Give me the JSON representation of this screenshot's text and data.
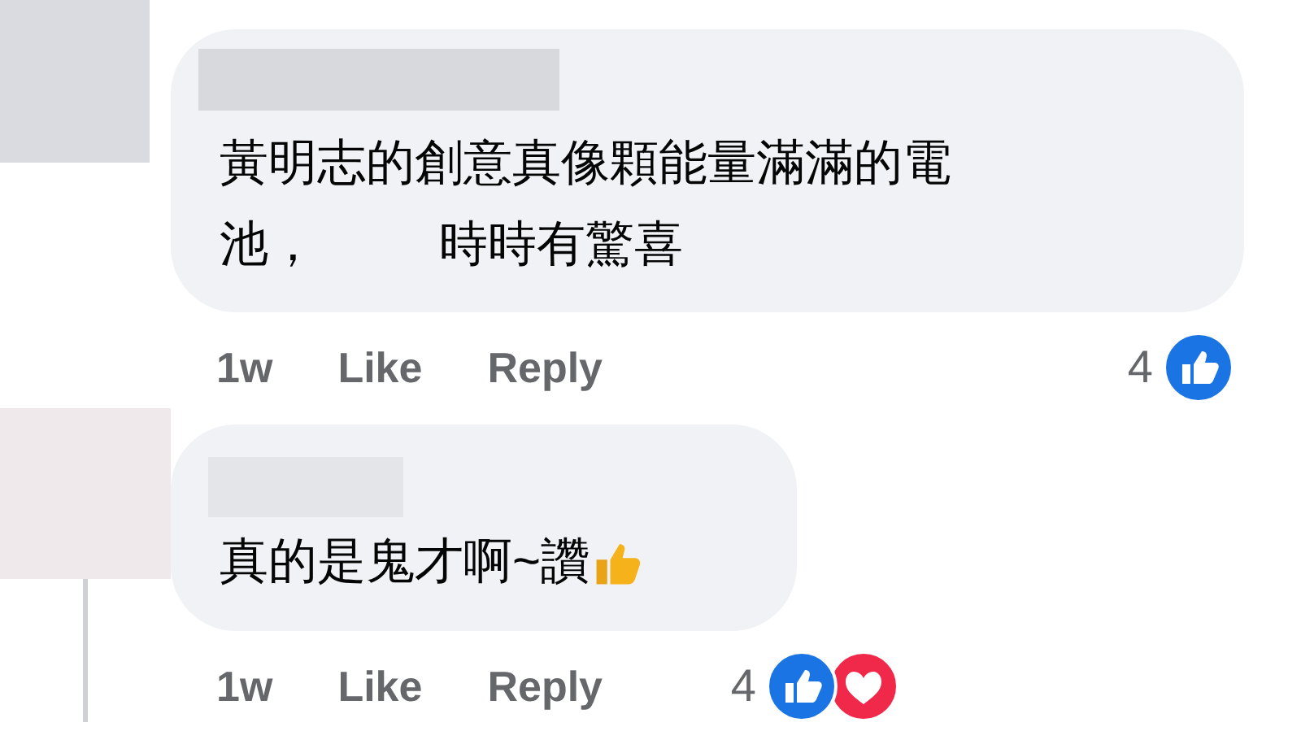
{
  "comments": [
    {
      "lines": [
        [
          "黃明志的創意真像顆能量滿滿的電"
        ],
        [
          "池，",
          "時時有驚喜"
        ]
      ],
      "emoji": false,
      "thread_line": false,
      "time": "1w",
      "like": "Like",
      "reply": "Reply",
      "reaction_count": "4",
      "reactions": [
        {
          "kind": "like"
        }
      ]
    },
    {
      "lines": [
        [
          "真的是鬼才啊~讚"
        ]
      ],
      "emoji": true,
      "thread_line": true,
      "time": "1w",
      "like": "Like",
      "reply": "Reply",
      "reaction_count": "4",
      "reactions": [
        {
          "kind": "like"
        },
        {
          "kind": "love"
        }
      ]
    }
  ]
}
